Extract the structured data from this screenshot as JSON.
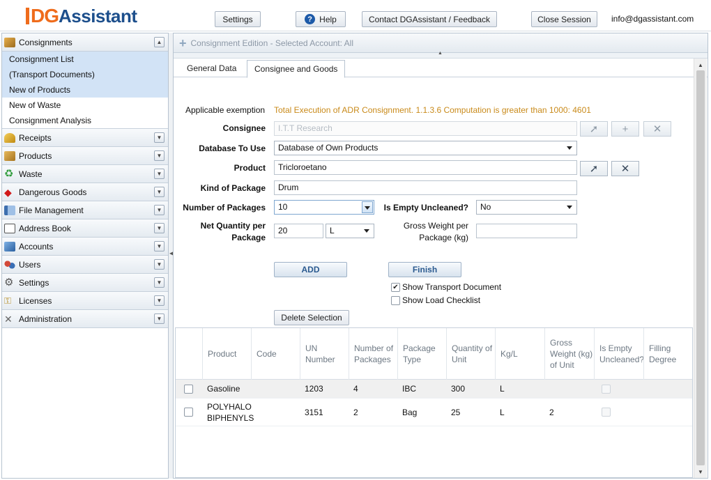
{
  "header": {
    "logo_dg": "DG",
    "logo_rest": "Assistant",
    "settings": "Settings",
    "help": "Help",
    "contact": "Contact DGAssistant / Feedback",
    "close": "Close Session",
    "email": "info@dgassistant.com"
  },
  "sidebar": {
    "sections": [
      {
        "label": "Consignments",
        "icon": "consignments-icon",
        "expanded": true
      },
      {
        "label": "Receipts",
        "icon": "receipts-icon"
      },
      {
        "label": "Products",
        "icon": "products-icon"
      },
      {
        "label": "Waste",
        "icon": "recycle-icon"
      },
      {
        "label": "Dangerous Goods",
        "icon": "hazard-diamond-icon"
      },
      {
        "label": "File Management",
        "icon": "file-icon"
      },
      {
        "label": "Address Book",
        "icon": "address-book-icon"
      },
      {
        "label": "Accounts",
        "icon": "accounts-icon"
      },
      {
        "label": "Users",
        "icon": "users-icon"
      },
      {
        "label": "Settings",
        "icon": "gear-icon"
      },
      {
        "label": "Licenses",
        "icon": "key-icon"
      },
      {
        "label": "Administration",
        "icon": "tools-icon"
      }
    ],
    "consignment_items": [
      "Consignment List",
      "(Transport Documents)",
      "New of Products",
      "New of Waste",
      "Consignment Analysis"
    ]
  },
  "panel": {
    "title": "Consignment Edition - Selected Account: All",
    "tabs": [
      "General Data",
      "Consignee and Goods"
    ],
    "active_tab": "Consignee and Goods"
  },
  "form": {
    "exemption_label": "Applicable exemption",
    "exemption_text": "Total Execution of ADR Consignment. 1.1.3.6 Computation is greater than 1000: 4601",
    "consignee_label": "Consignee",
    "consignee_placeholder": "I.T.T Research",
    "database_label": "Database To Use",
    "database_value": "Database of Own Products",
    "product_label": "Product",
    "product_value": "Tricloroetano",
    "kind_label": "Kind of Package",
    "kind_value": "Drum",
    "num_label": "Number of Packages",
    "num_value": "10",
    "empty_label": "Is Empty Uncleaned?",
    "empty_value": "No",
    "netqty_label_1": "Net Quantity per",
    "netqty_label_2": "Package",
    "netqty_value": "20",
    "netqty_unit": "L",
    "gross_label_1": "Gross Weight per",
    "gross_label_2": "Package (kg)",
    "gross_value": "",
    "add_button": "ADD",
    "finish_button": "Finish",
    "show_transport": "Show Transport Document",
    "show_transport_checked": true,
    "show_checklist": "Show Load Checklist",
    "show_checklist_checked": false,
    "delete_button": "Delete Selection"
  },
  "grid": {
    "headers": [
      "Product",
      "Code",
      "UN Number",
      "Number of Packages",
      "Package Type",
      "Quantity of Unit",
      "Kg/L",
      "Gross Weight (kg) of Unit",
      "Is Empty Uncleaned?",
      "Filling Degree"
    ],
    "rows": [
      {
        "product": "Gasoline",
        "code": "",
        "un": "1203",
        "packages": "4",
        "type": "IBC",
        "qty": "300",
        "kgl": "L",
        "gross": "",
        "empty": false,
        "filling": ""
      },
      {
        "product": "POLYHALO BIPHENYLS",
        "code": "",
        "un": "3151",
        "packages": "2",
        "type": "Bag",
        "qty": "25",
        "kgl": "L",
        "gross": "2",
        "empty": false,
        "filling": ""
      }
    ]
  },
  "colors": {
    "accent_orange": "#ef6c1c",
    "brand_blue": "#1d4f8c",
    "exemption_text": "#c98a1a",
    "selected_row": "#d2e3f6"
  }
}
